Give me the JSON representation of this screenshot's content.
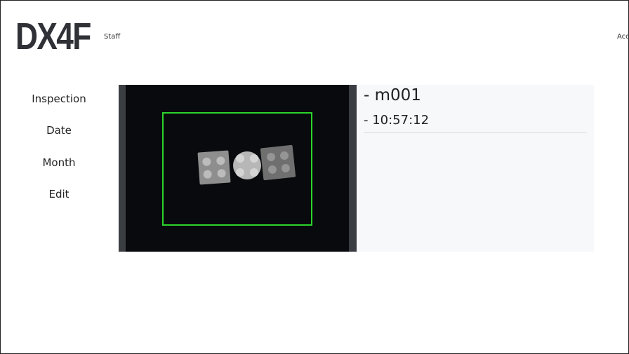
{
  "header": {
    "logo_text": "DX4F",
    "role_label": "Staff",
    "account_label": "Acc"
  },
  "nav": {
    "items": [
      {
        "label": "Inspection"
      },
      {
        "label": "Date"
      },
      {
        "label": "Month"
      },
      {
        "label": "Edit"
      }
    ]
  },
  "detail": {
    "model_line": "- m001",
    "time_line": "- 10:57:12"
  },
  "colors": {
    "detection_box": "#2bd42b",
    "camera_background": "#080a0d",
    "viewer_frame": "#3a3d42",
    "info_panel": "#f7f8fa"
  }
}
